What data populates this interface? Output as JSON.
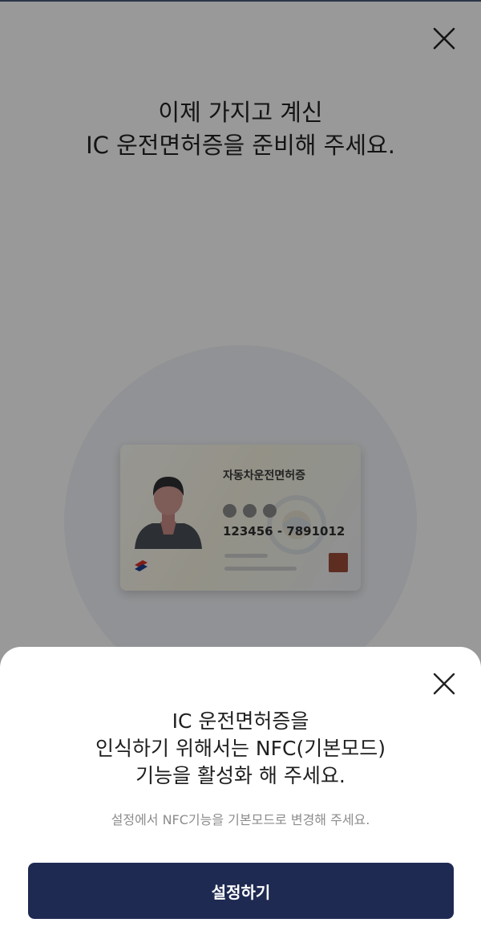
{
  "page": {
    "title_lines": [
      "이제 가지고 계신",
      "IC 운전면허증을 준비해 주세요."
    ],
    "close_icon": "close-icon"
  },
  "card": {
    "title": "자동차운전면허증",
    "number": "123456 - 7891012"
  },
  "sheet": {
    "close_icon": "close-icon",
    "title_lines": [
      "IC 운전면허증을",
      "인식하기 위해서는 NFC(기본모드)",
      "기능을 활성화 해 주세요."
    ],
    "description": "설정에서 NFC기능을 기본모드로 변경해 주세요.",
    "button_label": "설정하기"
  },
  "colors": {
    "primary_button": "#1f2a52",
    "overlay": "rgba(0,0,0,0.40)",
    "card_chip": "#9b4b3a"
  }
}
